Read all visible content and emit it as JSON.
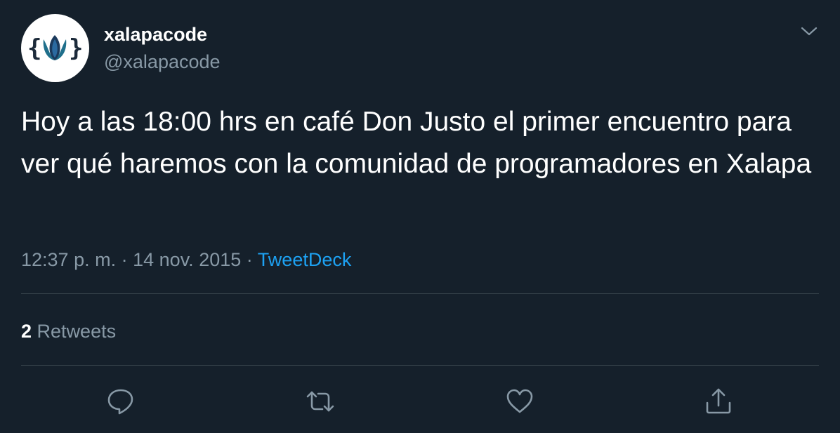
{
  "author": {
    "display_name": "xalapacode",
    "handle": "@xalapacode"
  },
  "tweet": {
    "text": "Hoy a las 18:00 hrs en café Don Justo el primer encuentro para ver qué haremos con la comunidad de programadores en Xalapa",
    "time": "12:37 p. m.",
    "separator": "·",
    "date": "14 nov. 2015",
    "source": "TweetDeck"
  },
  "stats": {
    "retweets_count": "2",
    "retweets_label": "Retweets"
  },
  "actions": {
    "reply_icon": "reply-icon",
    "retweet_icon": "retweet-icon",
    "like_icon": "heart-icon",
    "share_icon": "share-icon"
  },
  "colors": {
    "background": "#15202b",
    "text": "#ffffff",
    "secondary_text": "#8899a6",
    "link": "#1da1f2",
    "divider": "#38444d"
  }
}
